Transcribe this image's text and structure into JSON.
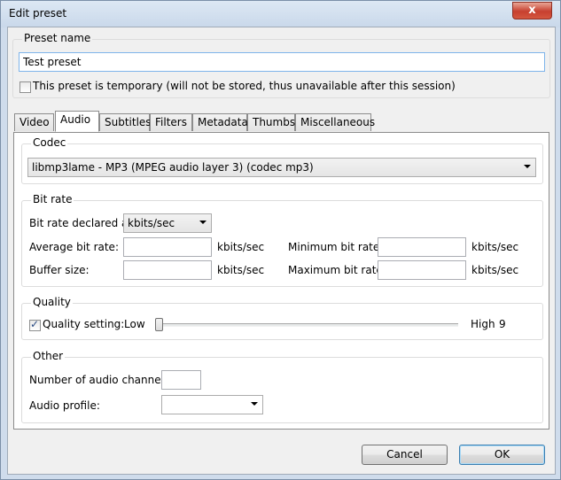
{
  "window": {
    "title": "Edit preset",
    "close_label": "x"
  },
  "preset_name": {
    "label": "Preset name",
    "value": "Test preset"
  },
  "temporary": {
    "label": "This preset is temporary (will not be stored, thus unavailable after this session)",
    "checked": false
  },
  "tabs": [
    {
      "label": "Video",
      "active": false
    },
    {
      "label": "Audio",
      "active": true
    },
    {
      "label": "Subtitles",
      "active": false
    },
    {
      "label": "Filters",
      "active": false
    },
    {
      "label": "Metadata",
      "active": false
    },
    {
      "label": "Thumbs",
      "active": false
    },
    {
      "label": "Miscellaneous",
      "active": false
    }
  ],
  "codec": {
    "label": "Codec",
    "selected": "libmp3lame - MP3 (MPEG audio layer 3) (codec mp3)"
  },
  "bitrate": {
    "label": "Bit rate",
    "declared_label": "Bit rate declared as:",
    "declared_value": "kbits/sec",
    "average_label": "Average bit rate:",
    "average_value": "",
    "average_unit": "kbits/sec",
    "buffer_label": "Buffer size:",
    "buffer_value": "",
    "buffer_unit": "kbits/sec",
    "minimum_label": "Minimum bit rate:",
    "minimum_value": "",
    "minimum_unit": "kbits/sec",
    "maximum_label": "Maximum bit rate:",
    "maximum_value": "",
    "maximum_unit": "kbits/sec"
  },
  "quality": {
    "label": "Quality",
    "setting_label": "Quality setting:",
    "checked": true,
    "low_label": "Low",
    "high_label": "High",
    "value": "9",
    "slider_fraction": 0.0
  },
  "other": {
    "label": "Other",
    "channels_label": "Number of audio channels:",
    "channels_value": "",
    "profile_label": "Audio profile:",
    "profile_value": ""
  },
  "buttons": {
    "cancel": "Cancel",
    "ok": "OK"
  }
}
